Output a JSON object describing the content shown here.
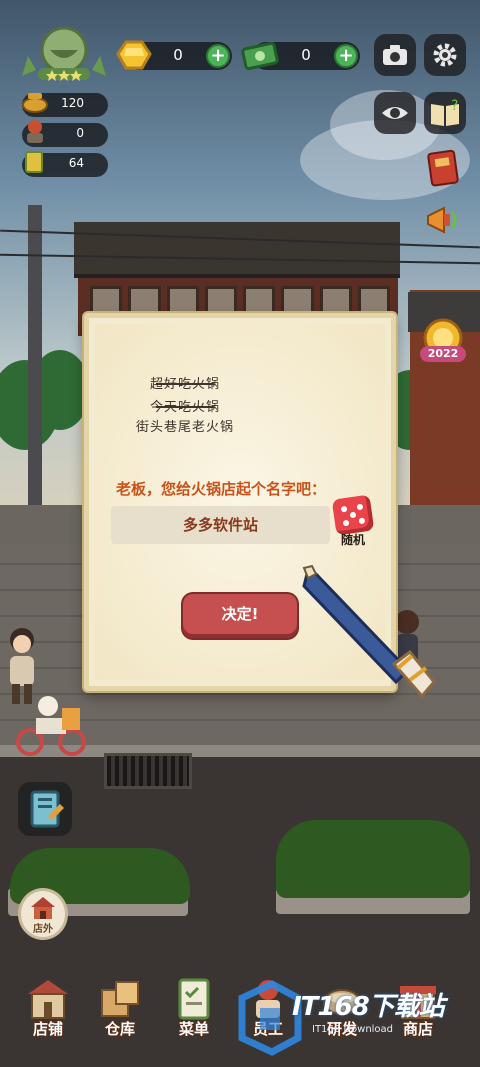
{
  "hud": {
    "currency_gold": "0",
    "currency_cash": "0",
    "stat_food": "120",
    "stat_staff": "0",
    "stat_tickets": "64"
  },
  "right_buttons": [
    "camera-icon",
    "gear-icon",
    "eye-icon",
    "help-book-icon",
    "recipe-book-icon",
    "megaphone-icon"
  ],
  "event_badge": "2022",
  "dialog": {
    "history": [
      "超好吃火锅",
      "今天吃火锅",
      "街头巷尾老火锅"
    ],
    "history_struck": [
      true,
      true,
      false
    ],
    "prompt": "老板，您给火锅店起个名字吧：",
    "name_value": "多多软件站",
    "random_label": "随机",
    "confirm_label": "决定!"
  },
  "outside_label": "店外",
  "nav": [
    "店铺",
    "仓库",
    "菜单",
    "员工",
    "研发",
    "商店"
  ],
  "watermark": {
    "main": "IT168下载站",
    "sub": "IT168 Download"
  },
  "colors": {
    "prompt": "#c8541c",
    "confirm": "#c6504f",
    "plus": "#4fb35a"
  }
}
